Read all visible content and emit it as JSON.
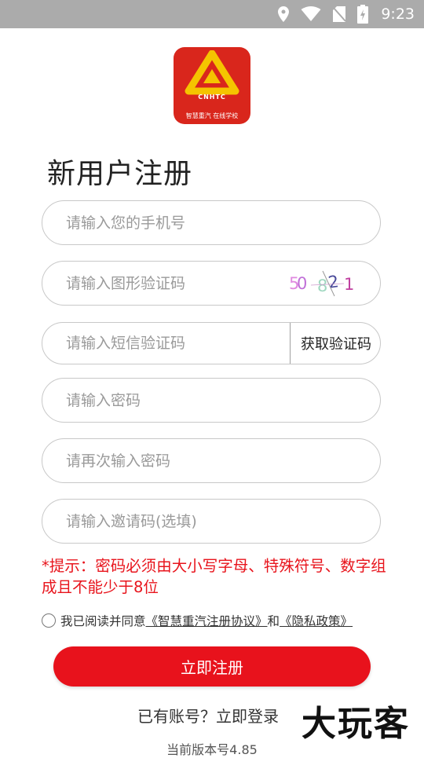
{
  "status_bar": {
    "time": "9:23",
    "icons": [
      "location-icon",
      "wifi-icon",
      "no-sim-icon",
      "battery-icon"
    ]
  },
  "logo": {
    "brand": "CNHTC",
    "subtitle": "智慧重汽 在线学校"
  },
  "page": {
    "title": "新用户注册"
  },
  "form": {
    "phone_placeholder": "请输入您的手机号",
    "captcha_placeholder": "请输入图形验证码",
    "captcha_chars": [
      "5",
      "0",
      "8",
      "2",
      "1"
    ],
    "sms_placeholder": "请输入短信验证码",
    "sms_button": "获取验证码",
    "password_placeholder": "请输入密码",
    "confirm_password_placeholder": "请再次输入密码",
    "invite_placeholder": "请输入邀请码(选填)"
  },
  "hint": "*提示：密码必须由大小写字母、特殊符号、数字组成且不能少于8位",
  "agreement": {
    "prefix": "我已阅读并同意",
    "user_agreement": "《智慧重汽注册协议》",
    "and": "和",
    "privacy_policy": "《隐私政策》"
  },
  "register_button": "立即注册",
  "login_link": "已有账号？立即登录",
  "version": "当前版本号4.85",
  "watermark": "大玩客",
  "colors": {
    "accent": "#e8121c",
    "hint": "#e8141c",
    "status_bar": "#ababab",
    "captcha": [
      "#e08ae0",
      "#c070d8",
      "#a0d8c0",
      "#4a4a9a",
      "#c040a0"
    ]
  }
}
